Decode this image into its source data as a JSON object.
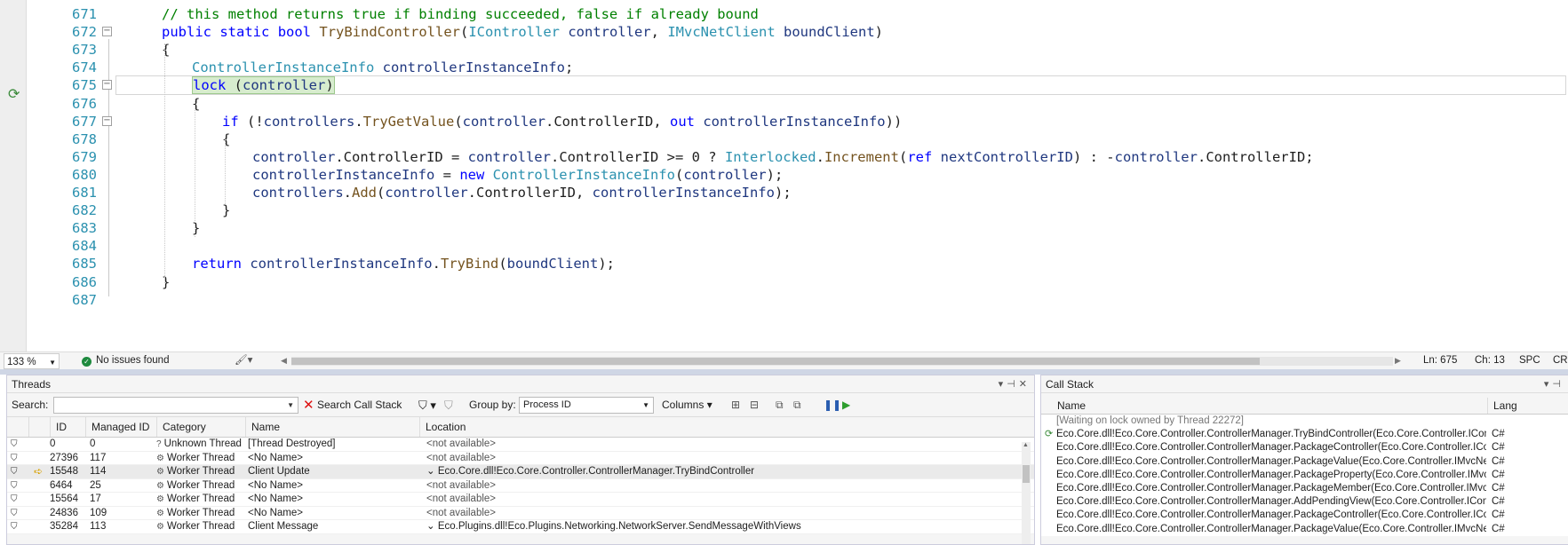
{
  "editor": {
    "lines": [
      {
        "num": "671",
        "text": "// this method returns true if binding succeeded, false if already bound"
      },
      {
        "num": "672",
        "text": "public static bool TryBindController(IController controller, IMvcNetClient boundClient)"
      },
      {
        "num": "673",
        "text": "{"
      },
      {
        "num": "674",
        "text": "ControllerInstanceInfo controllerInstanceInfo;"
      },
      {
        "num": "675",
        "text": "lock (controller)"
      },
      {
        "num": "676",
        "text": "{"
      },
      {
        "num": "677",
        "text": "if (!controllers.TryGetValue(controller.ControllerID, out controllerInstanceInfo))"
      },
      {
        "num": "678",
        "text": "{"
      },
      {
        "num": "679",
        "text": "controller.ControllerID = controller.ControllerID >= 0 ? Interlocked.Increment(ref nextControllerID) : -controller.ControllerID;"
      },
      {
        "num": "680",
        "text": "controllerInstanceInfo = new ControllerInstanceInfo(controller);"
      },
      {
        "num": "681",
        "text": "controllers.Add(controller.ControllerID, controllerInstanceInfo);"
      },
      {
        "num": "682",
        "text": "}"
      },
      {
        "num": "683",
        "text": "}"
      },
      {
        "num": "684",
        "text": ""
      },
      {
        "num": "685",
        "text": "return controllerInstanceInfo.TryBind(boundClient);"
      },
      {
        "num": "686",
        "text": "}"
      },
      {
        "num": "687",
        "text": ""
      }
    ],
    "current_line": "675",
    "waiting_icon": "waiting-on-lock-icon"
  },
  "status_bar": {
    "zoom": "133 %",
    "issues": "No issues found",
    "line": "Ln: 675",
    "column": "Ch: 13",
    "spacing": "SPC",
    "line_ending": "CRL"
  },
  "threads": {
    "title": "Threads",
    "search_label": "Search:",
    "search_value": "",
    "search_call_stack": "Search Call Stack",
    "group_by_label": "Group by:",
    "group_by_value": "Process ID",
    "columns_label": "Columns",
    "headers": {
      "id": "ID",
      "managed_id": "Managed ID",
      "category": "Category",
      "name": "Name",
      "location": "Location"
    },
    "rows": [
      {
        "id": "0",
        "managed_id": "0",
        "category": "Unknown Thread",
        "cat_icon": "?",
        "name": "[Thread Destroyed]",
        "location": "<not available>",
        "current": false
      },
      {
        "id": "27396",
        "managed_id": "117",
        "category": "Worker Thread",
        "cat_icon": "⚙",
        "name": "<No Name>",
        "location": "<not available>",
        "current": false
      },
      {
        "id": "15548",
        "managed_id": "114",
        "category": "Worker Thread",
        "cat_icon": "⚙",
        "name": "Client Update",
        "location": "Eco.Core.dll!Eco.Core.Controller.ControllerManager.TryBindController",
        "current": true
      },
      {
        "id": "6464",
        "managed_id": "25",
        "category": "Worker Thread",
        "cat_icon": "⚙",
        "name": "<No Name>",
        "location": "<not available>",
        "current": false
      },
      {
        "id": "15564",
        "managed_id": "17",
        "category": "Worker Thread",
        "cat_icon": "⚙",
        "name": "<No Name>",
        "location": "<not available>",
        "current": false
      },
      {
        "id": "24836",
        "managed_id": "109",
        "category": "Worker Thread",
        "cat_icon": "⚙",
        "name": "<No Name>",
        "location": "<not available>",
        "current": false
      },
      {
        "id": "35284",
        "managed_id": "113",
        "category": "Worker Thread",
        "cat_icon": "⚙",
        "name": "Client Message",
        "location": "Eco.Plugins.dll!Eco.Plugins.Networking.NetworkServer.SendMessageWithViews",
        "current": false
      }
    ]
  },
  "callstack": {
    "title": "Call Stack",
    "headers": {
      "name": "Name",
      "language": "Lang"
    },
    "rows": [
      {
        "name": "[Waiting on lock owned by Thread 22272]",
        "language": "",
        "waiting": true,
        "current": false
      },
      {
        "name": "Eco.Core.dll!Eco.Core.Controller.ControllerManager.TryBindController(Eco.Core.Controller.IController ...",
        "language": "C#",
        "waiting": false,
        "current": true
      },
      {
        "name": "Eco.Core.dll!Eco.Core.Controller.ControllerManager.PackageController(Eco.Core.Controller.IControlle...",
        "language": "C#",
        "waiting": false,
        "current": false
      },
      {
        "name": "Eco.Core.dll!Eco.Core.Controller.ControllerManager.PackageValue(Eco.Core.Controller.IMvcNetClient ...",
        "language": "C#",
        "waiting": false,
        "current": false
      },
      {
        "name": "Eco.Core.dll!Eco.Core.Controller.ControllerManager.PackageProperty(Eco.Core.Controller.IMvcNetCli...",
        "language": "C#",
        "waiting": false,
        "current": false
      },
      {
        "name": "Eco.Core.dll!Eco.Core.Controller.ControllerManager.PackageMember(Eco.Core.Controller.IMvcNetClie...",
        "language": "C#",
        "waiting": false,
        "current": false
      },
      {
        "name": "Eco.Core.dll!Eco.Core.Controller.ControllerManager.AddPendingView(Eco.Core.Controller.IController ...",
        "language": "C#",
        "waiting": false,
        "current": false
      },
      {
        "name": "Eco.Core.dll!Eco.Core.Controller.ControllerManager.PackageController(Eco.Core.Controller.IControlle...",
        "language": "C#",
        "waiting": false,
        "current": false
      },
      {
        "name": "Eco.Core.dll!Eco.Core.Controller.ControllerManager.PackageValue(Eco.Core.Controller.IMvcNetClient ...",
        "language": "C#",
        "waiting": false,
        "current": false
      }
    ]
  }
}
